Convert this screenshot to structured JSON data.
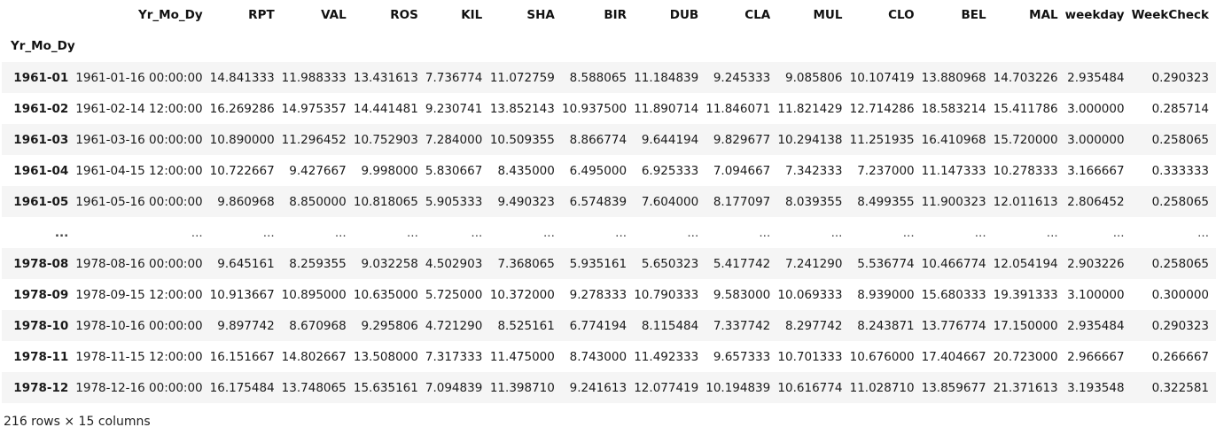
{
  "table": {
    "columns": [
      "Yr_Mo_Dy",
      "RPT",
      "VAL",
      "ROS",
      "KIL",
      "SHA",
      "BIR",
      "DUB",
      "CLA",
      "MUL",
      "CLO",
      "BEL",
      "MAL",
      "weekday",
      "WeekCheck"
    ],
    "index_name": "Yr_Mo_Dy",
    "rows": [
      [
        "1961-01",
        "1961-01-16 00:00:00",
        "14.841333",
        "11.988333",
        "13.431613",
        "7.736774",
        "11.072759",
        "8.588065",
        "11.184839",
        "9.245333",
        "9.085806",
        "10.107419",
        "13.880968",
        "14.703226",
        "2.935484",
        "0.290323"
      ],
      [
        "1961-02",
        "1961-02-14 12:00:00",
        "16.269286",
        "14.975357",
        "14.441481",
        "9.230741",
        "13.852143",
        "10.937500",
        "11.890714",
        "11.846071",
        "11.821429",
        "12.714286",
        "18.583214",
        "15.411786",
        "3.000000",
        "0.285714"
      ],
      [
        "1961-03",
        "1961-03-16 00:00:00",
        "10.890000",
        "11.296452",
        "10.752903",
        "7.284000",
        "10.509355",
        "8.866774",
        "9.644194",
        "9.829677",
        "10.294138",
        "11.251935",
        "16.410968",
        "15.720000",
        "3.000000",
        "0.258065"
      ],
      [
        "1961-04",
        "1961-04-15 12:00:00",
        "10.722667",
        "9.427667",
        "9.998000",
        "5.830667",
        "8.435000",
        "6.495000",
        "6.925333",
        "7.094667",
        "7.342333",
        "7.237000",
        "11.147333",
        "10.278333",
        "3.166667",
        "0.333333"
      ],
      [
        "1961-05",
        "1961-05-16 00:00:00",
        "9.860968",
        "8.850000",
        "10.818065",
        "5.905333",
        "9.490323",
        "6.574839",
        "7.604000",
        "8.177097",
        "8.039355",
        "8.499355",
        "11.900323",
        "12.011613",
        "2.806452",
        "0.258065"
      ],
      [
        "...",
        "...",
        "...",
        "...",
        "...",
        "...",
        "...",
        "...",
        "...",
        "...",
        "...",
        "...",
        "...",
        "...",
        "...",
        "..."
      ],
      [
        "1978-08",
        "1978-08-16 00:00:00",
        "9.645161",
        "8.259355",
        "9.032258",
        "4.502903",
        "7.368065",
        "5.935161",
        "5.650323",
        "5.417742",
        "7.241290",
        "5.536774",
        "10.466774",
        "12.054194",
        "2.903226",
        "0.258065"
      ],
      [
        "1978-09",
        "1978-09-15 12:00:00",
        "10.913667",
        "10.895000",
        "10.635000",
        "5.725000",
        "10.372000",
        "9.278333",
        "10.790333",
        "9.583000",
        "10.069333",
        "8.939000",
        "15.680333",
        "19.391333",
        "3.100000",
        "0.300000"
      ],
      [
        "1978-10",
        "1978-10-16 00:00:00",
        "9.897742",
        "8.670968",
        "9.295806",
        "4.721290",
        "8.525161",
        "6.774194",
        "8.115484",
        "7.337742",
        "8.297742",
        "8.243871",
        "13.776774",
        "17.150000",
        "2.935484",
        "0.290323"
      ],
      [
        "1978-11",
        "1978-11-15 12:00:00",
        "16.151667",
        "14.802667",
        "13.508000",
        "7.317333",
        "11.475000",
        "8.743000",
        "11.492333",
        "9.657333",
        "10.701333",
        "10.676000",
        "17.404667",
        "20.723000",
        "2.966667",
        "0.266667"
      ],
      [
        "1978-12",
        "1978-12-16 00:00:00",
        "16.175484",
        "13.748065",
        "15.635161",
        "7.094839",
        "11.398710",
        "9.241613",
        "12.077419",
        "10.194839",
        "10.616774",
        "11.028710",
        "13.859677",
        "21.371613",
        "3.193548",
        "0.322581"
      ]
    ]
  },
  "footer": {
    "summary": "216 rows × 15 columns"
  }
}
